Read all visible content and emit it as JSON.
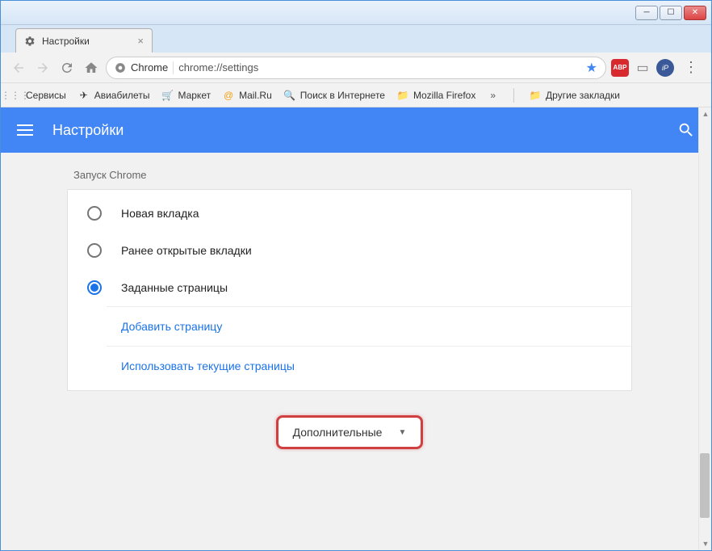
{
  "window": {
    "tab_title": "Настройки"
  },
  "omnibox": {
    "protocol_label": "Chrome",
    "url": "chrome://settings"
  },
  "bookmarks": {
    "services": "Сервисы",
    "flights": "Авиабилеты",
    "market": "Маркет",
    "mailru": "Mail.Ru",
    "search_web": "Поиск в Интернете",
    "firefox": "Mozilla Firefox",
    "more": "»",
    "other": "Другие закладки"
  },
  "settings": {
    "header_title": "Настройки",
    "section_on_startup": "Запуск Chrome",
    "radio_new_tab": "Новая вкладка",
    "radio_continue": "Ранее открытые вкладки",
    "radio_specific": "Заданные страницы",
    "link_add_page": "Добавить страницу",
    "link_use_current": "Использовать текущие страницы",
    "advanced": "Дополнительные"
  }
}
